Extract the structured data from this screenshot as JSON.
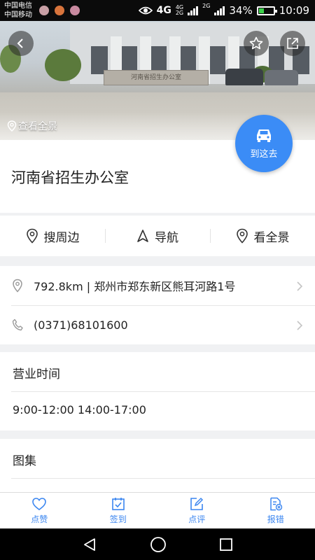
{
  "status_bar": {
    "carrier_1": "中国电信",
    "carrier_2": "中国移动",
    "network": "4G",
    "mini_labels": [
      "4G",
      "2G",
      "2G"
    ],
    "battery": "34%",
    "battery_level": 0.34,
    "time": "10:09"
  },
  "hero": {
    "gate_sign": "河南省招生办公室",
    "panorama_label": "查看全景"
  },
  "go_here": {
    "label": "到这去"
  },
  "place": {
    "title": "河南省招生办公室"
  },
  "actions": [
    {
      "label": "搜周边",
      "icon": "location-pin-icon"
    },
    {
      "label": "导航",
      "icon": "navigation-arrow-icon"
    },
    {
      "label": "看全景",
      "icon": "location-pin-icon"
    }
  ],
  "info": {
    "address": "792.8km | 郑州市郑东新区熊耳河路1号",
    "phone": "(0371)68101600"
  },
  "hours": {
    "label": "营业时间",
    "value": "9:00-12:00 14:00-17:00"
  },
  "gallery": {
    "label": "图集"
  },
  "tabs": [
    {
      "label": "点赞",
      "icon": "heart-icon"
    },
    {
      "label": "签到",
      "icon": "checkin-icon"
    },
    {
      "label": "点评",
      "icon": "edit-icon"
    },
    {
      "label": "报错",
      "icon": "report-error-icon"
    }
  ],
  "colors": {
    "accent": "#3b8cf6",
    "tab_blue": "#3b86f0"
  }
}
